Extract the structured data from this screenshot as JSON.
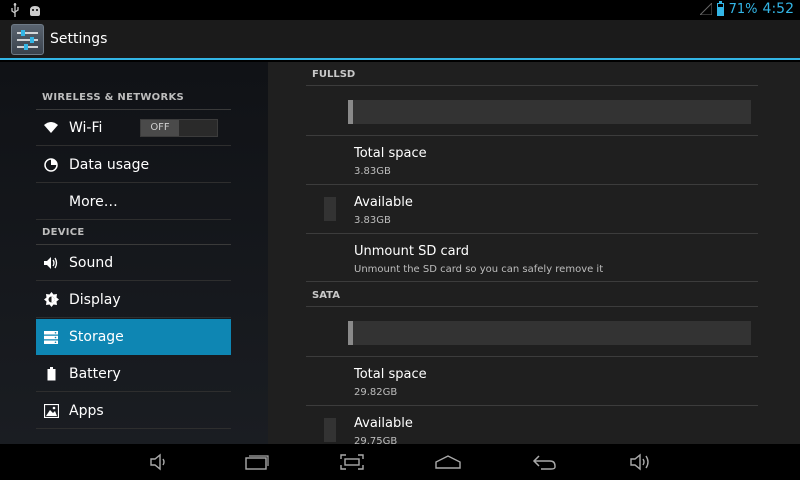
{
  "status_bar": {
    "left_icons": [
      "usb-icon",
      "android-debug-icon"
    ],
    "battery_percent": "71%",
    "battery_level": 0.71,
    "time": "4:52",
    "accent": "#33b5e5"
  },
  "action_bar": {
    "title": "Settings",
    "icon": "settings-app-icon"
  },
  "sidebar": {
    "sections": [
      {
        "header": "WIRELESS & NETWORKS"
      },
      {
        "header": "DEVICE"
      }
    ],
    "items": [
      {
        "label": "Wi-Fi",
        "icon": "wifi-icon",
        "toggle": "OFF"
      },
      {
        "label": "Data usage",
        "icon": "data-usage-icon"
      },
      {
        "label": "More…",
        "icon": ""
      },
      {
        "label": "Sound",
        "icon": "speaker-icon"
      },
      {
        "label": "Display",
        "icon": "brightness-icon"
      },
      {
        "label": "Storage",
        "icon": "storage-icon",
        "selected": true
      },
      {
        "label": "Battery",
        "icon": "battery-icon"
      },
      {
        "label": "Apps",
        "icon": "apps-icon"
      }
    ],
    "selected_color": "#0e86b3"
  },
  "storage": {
    "volumes": [
      {
        "header": "FULLSD",
        "usage_fraction": 0.01,
        "total_title": "Total space",
        "total_value": "3.83GB",
        "available_title": "Available",
        "available_value": "3.83GB",
        "unmount_title": "Unmount SD card",
        "unmount_summary": "Unmount the SD card so you can safely remove it"
      },
      {
        "header": "SATA",
        "usage_fraction": 0.01,
        "total_title": "Total space",
        "total_value": "29.82GB",
        "available_title": "Available",
        "available_value": "29.75GB"
      }
    ]
  },
  "nav_bar": {
    "buttons": [
      "volume-down-icon",
      "recent-apps-icon",
      "screenshot-icon",
      "home-icon",
      "back-icon",
      "volume-up-icon"
    ]
  }
}
